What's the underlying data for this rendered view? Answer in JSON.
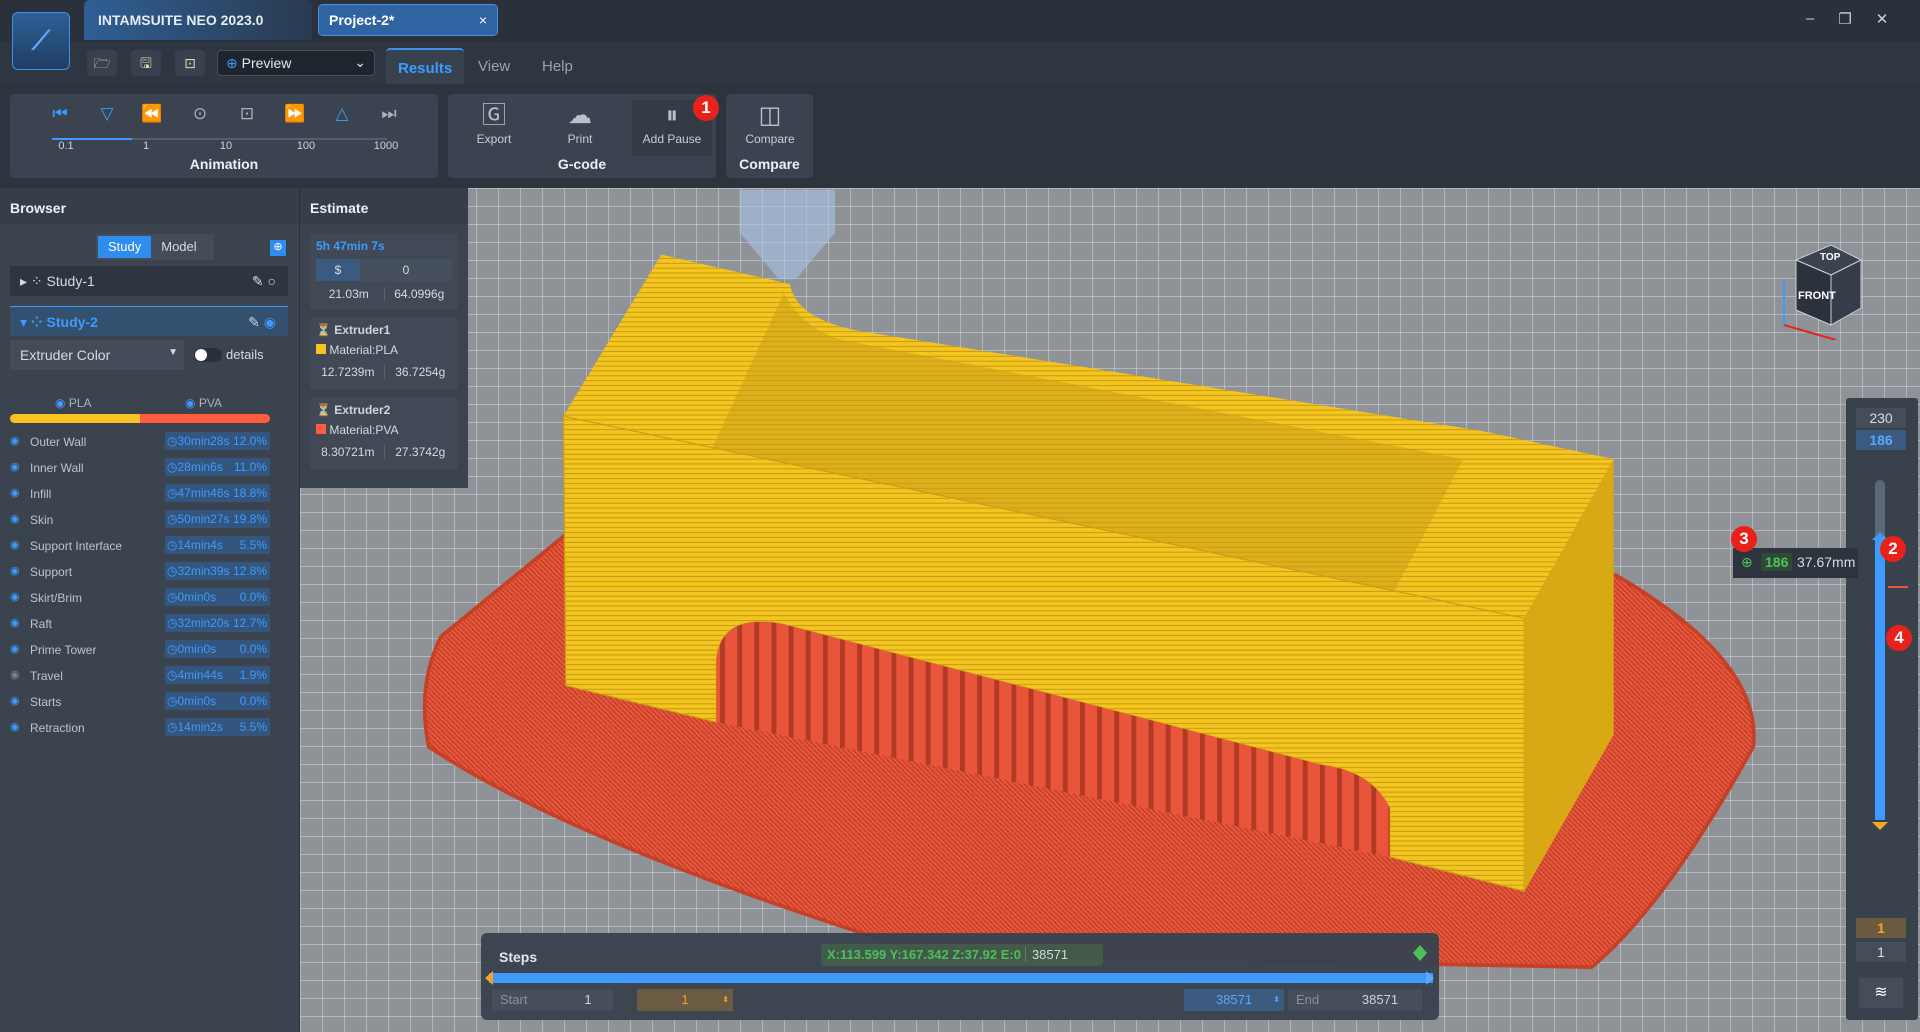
{
  "app": {
    "title": "INTAMSUITE NEO 2023.0",
    "project_tab": "Project-2*",
    "close": "×",
    "window": {
      "minimize": "–",
      "restore": "❐",
      "close": "✕"
    }
  },
  "toolbar": {
    "mode": "Preview",
    "tabs": [
      {
        "label": "Results",
        "active": true
      },
      {
        "label": "View"
      },
      {
        "label": "Help"
      }
    ]
  },
  "ribbon": {
    "animation": {
      "label": "Animation",
      "speeds": [
        "0.1",
        "1",
        "10",
        "100",
        "1000"
      ],
      "selected_speed": "1"
    },
    "gcode": {
      "label": "G-code",
      "export": "Export",
      "print": "Print",
      "add_pause": "Add Pause"
    },
    "compare": {
      "label": "Compare",
      "button": "Compare"
    }
  },
  "badges": [
    "1",
    "2",
    "3",
    "4"
  ],
  "browser": {
    "title": "Browser",
    "segments": [
      "Study",
      "Model"
    ],
    "studies": [
      {
        "name": "Study-1",
        "active": false
      },
      {
        "name": "Study-2",
        "active": true
      }
    ],
    "color_mode": "Extruder Color",
    "details_label": "details",
    "details_on": false,
    "materials": [
      {
        "name": "PLA",
        "color": "#f9c423"
      },
      {
        "name": "PVA",
        "color": "#ff5b3f"
      }
    ],
    "features": [
      {
        "name": "Outer Wall",
        "time": "30min28s",
        "pct": "12.0%",
        "visible": true
      },
      {
        "name": "Inner Wall",
        "time": "28min6s",
        "pct": "11.0%",
        "visible": true
      },
      {
        "name": "Infill",
        "time": "47min46s",
        "pct": "18.8%",
        "visible": true
      },
      {
        "name": "Skin",
        "time": "50min27s",
        "pct": "19.8%",
        "visible": true
      },
      {
        "name": "Support Interface",
        "time": "14min4s",
        "pct": "5.5%",
        "visible": true
      },
      {
        "name": "Support",
        "time": "32min39s",
        "pct": "12.8%",
        "visible": true
      },
      {
        "name": "Skirt/Brim",
        "time": "0min0s",
        "pct": "0.0%",
        "visible": true
      },
      {
        "name": "Raft",
        "time": "32min20s",
        "pct": "12.7%",
        "visible": true
      },
      {
        "name": "Prime Tower",
        "time": "0min0s",
        "pct": "0.0%",
        "visible": true
      },
      {
        "name": "Travel",
        "time": "4min44s",
        "pct": "1.9%",
        "visible": false
      },
      {
        "name": "Starts",
        "time": "0min0s",
        "pct": "0.0%",
        "visible": true
      },
      {
        "name": "Retraction",
        "time": "14min2s",
        "pct": "5.5%",
        "visible": true
      }
    ]
  },
  "estimate": {
    "title": "Estimate",
    "total_time": "5h 47min 7s",
    "cost_symbol": "$",
    "cost": "0",
    "length": "21.03m",
    "weight": "64.0996g",
    "extruders": [
      {
        "name": "Extruder1",
        "material": "Material:PLA",
        "color": "#f9c423",
        "length": "12.7239m",
        "weight": "36.7254g"
      },
      {
        "name": "Extruder2",
        "material": "Material:PVA",
        "color": "#ff5b3f",
        "length": "8.30721m",
        "weight": "27.3742g"
      }
    ]
  },
  "viewcube": {
    "top": "TOP",
    "front": "FRONT"
  },
  "layers": {
    "max": "230",
    "upper": "186",
    "lower": "1",
    "min": "1",
    "tooltip_layer": "186",
    "tooltip_height": "37.67mm"
  },
  "steps": {
    "label": "Steps",
    "coords": "X:113.599 Y:167.342 Z:37.92 E:0",
    "current": "38571",
    "start_label": "Start",
    "start": "1",
    "start_value": "1",
    "end_value": "38571",
    "end_label": "End",
    "end": "38571"
  }
}
